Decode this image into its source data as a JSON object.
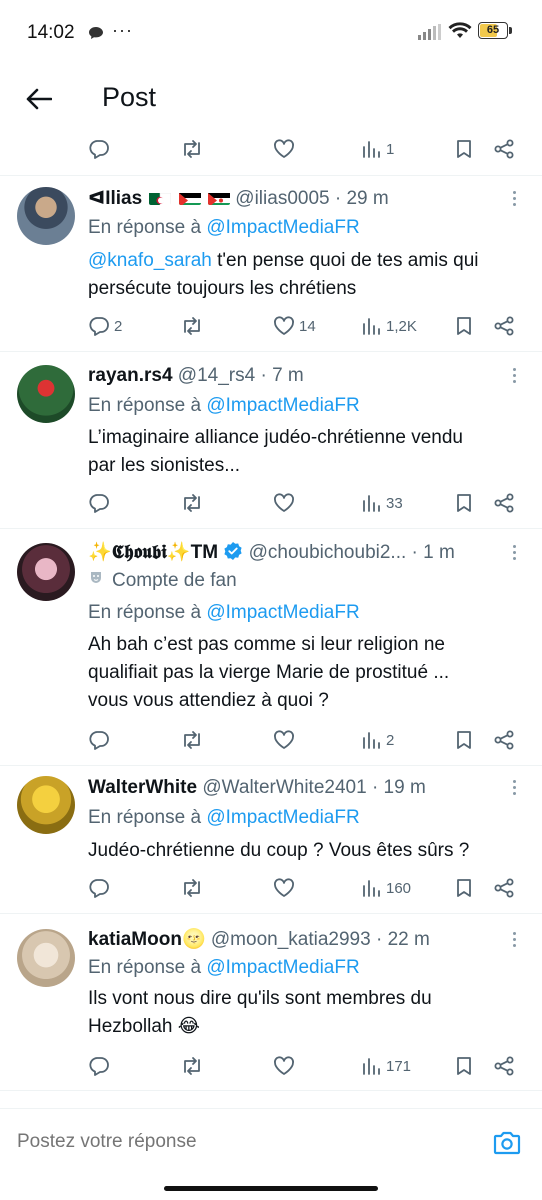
{
  "status_bar": {
    "time": "14:02",
    "battery": "65"
  },
  "header": {
    "title": "Post"
  },
  "top_actions": {
    "views": "1"
  },
  "reply_prefix": "En réponse à",
  "tweets": [
    {
      "name": "ᐊIlias",
      "flags": [
        "dz",
        "ps",
        "eh"
      ],
      "handle": "@ilias0005",
      "time": "· 29 m",
      "reply_to": "@ImpactMediaFR",
      "mention": "@knafo_sarah",
      "text_line1": " t'en pense quoi de tes amis qui",
      "text_line2": "persécute toujours les chrétiens",
      "replies": "2",
      "likes": "14",
      "views": "1,2K"
    },
    {
      "name": "rayan.rs4",
      "handle": "@14_rs4",
      "time": "· 7 m",
      "reply_to": "@ImpactMediaFR",
      "text_line1": "L’imaginaire alliance judéo-chrétienne vendu",
      "text_line2": "par les sionistes...",
      "views": "33"
    },
    {
      "name": "✨𝕮𝖍𝖔𝖚𝖇𝖎✨TM",
      "handle": "@choubichoubi2...",
      "time": "· 1 m",
      "badge": "Compte de fan",
      "reply_to": "@ImpactMediaFR",
      "text_line1": "Ah bah c’est pas comme si leur religion ne",
      "text_line2": "qualifiait pas la vierge Marie de prostitué ...",
      "text_line3": "vous vous attendiez à quoi ?",
      "views": "2"
    },
    {
      "name": "WalterWhite",
      "handle": "@WalterWhite2401",
      "time": "· 19 m",
      "reply_to": "@ImpactMediaFR",
      "text_line1": "Judéo-chrétienne du coup ? Vous êtes sûrs ?",
      "views": "160"
    },
    {
      "name": "katiaMoon🌝",
      "handle": "@moon_katia2993",
      "time": "· 22 m",
      "reply_to": "@ImpactMediaFR",
      "text_line1": "Ils vont nous dire qu'ils sont membres du",
      "text_line2": "Hezbollah 😂",
      "views": "171"
    }
  ],
  "reply_bar": {
    "placeholder": "Postez votre réponse"
  },
  "colors": {
    "accent": "#1d9bf0",
    "muted": "#536471",
    "text": "#0f1419"
  }
}
